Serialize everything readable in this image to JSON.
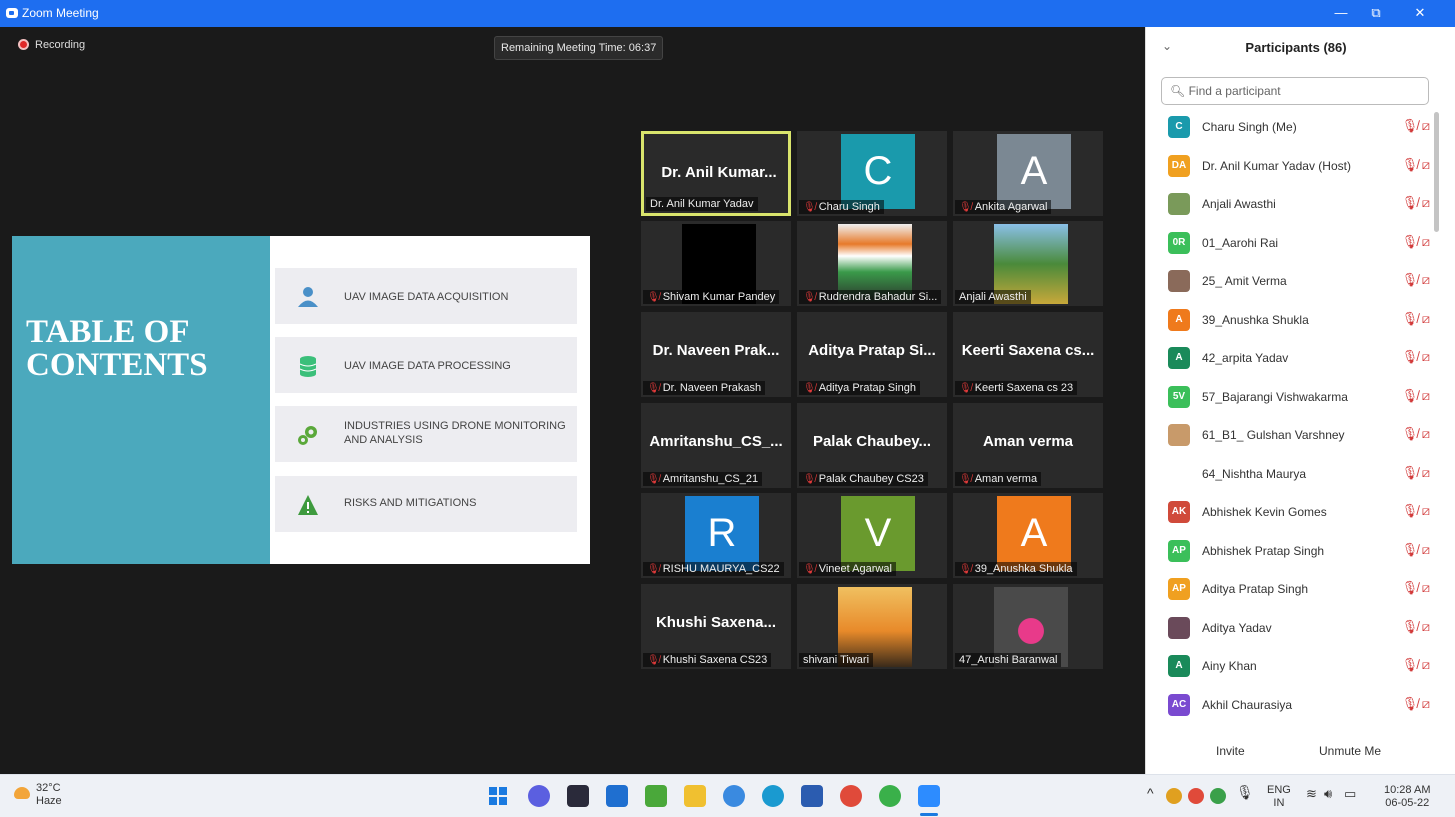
{
  "window": {
    "title": "Zoom Meeting",
    "min": "—",
    "restore": "⧉",
    "close": "✕"
  },
  "recording": "Recording",
  "timer": "Remaining Meeting Time: 06:37",
  "slide": {
    "title_line1": "TABLE OF",
    "title_line2": "CONTENTS",
    "items": [
      {
        "label": "UAV IMAGE DATA ACQUISITION",
        "icon": "person-icon",
        "color": "#4a90c8"
      },
      {
        "label": "UAV IMAGE DATA  PROCESSING",
        "icon": "database-icon",
        "color": "#3bbf7a"
      },
      {
        "label": "INDUSTRIES USING DRONE MONITORING AND ANALYSIS",
        "icon": "gears-icon",
        "color": "#5aa83a"
      },
      {
        "label": "RISKS AND MITIGATIONS",
        "icon": "warning-icon",
        "color": "#3e9a3e"
      }
    ]
  },
  "tiles": [
    {
      "big": "Dr. Anil Kumar...",
      "name": "Dr. Anil Kumar Yadav",
      "muted": false,
      "active": true
    },
    {
      "avatar": "C",
      "avatar_color": "#1a9aac",
      "name": "Charu Singh",
      "muted": true
    },
    {
      "avatar": "A",
      "avatar_color": "#7b8893",
      "name": "Ankita Agarwal",
      "muted": true
    },
    {
      "photo": "black",
      "name": "Shivam Kumar Pandey",
      "muted": true
    },
    {
      "photo": "person",
      "name": "Rudrendra Bahadur Si...",
      "muted": true
    },
    {
      "photo": "garden",
      "name": "Anjali Awasthi",
      "muted": false
    },
    {
      "big": "Dr. Naveen Prak...",
      "name": "Dr. Naveen Prakash",
      "muted": true
    },
    {
      "big": "Aditya Pratap Si...",
      "name": "Aditya Pratap Singh",
      "muted": true
    },
    {
      "big": "Keerti Saxena cs...",
      "name": "Keerti Saxena cs 23",
      "muted": true
    },
    {
      "big": "Amritanshu_CS_...",
      "name": "Amritanshu_CS_21",
      "muted": true
    },
    {
      "big": "Palak Chaubey...",
      "name": "Palak Chaubey  CS23",
      "muted": true
    },
    {
      "big": "Aman verma",
      "name": "Aman verma",
      "muted": true
    },
    {
      "avatar": "R",
      "avatar_color": "#1a7fd0",
      "name": "RISHU MAURYA_CS22",
      "muted": true
    },
    {
      "avatar": "V",
      "avatar_color": "#6a9a2e",
      "name": "Vineet Agarwal",
      "muted": true
    },
    {
      "avatar": "A",
      "avatar_color": "#ef7a1c",
      "name": "39_Anushka Shukla",
      "muted": true
    },
    {
      "big": "Khushi Saxena...",
      "name": "Khushi Saxena CS23",
      "muted": true
    },
    {
      "photo": "meditation",
      "name": "shivani Tiwari",
      "muted": false
    },
    {
      "photo": "flower",
      "name": "47_Arushi Baranwal",
      "muted": false
    }
  ],
  "participants": {
    "title": "Participants (86)",
    "search_placeholder": "Find a participant",
    "list": [
      {
        "initials": "C",
        "color": "#1a9aac",
        "name": "Charu Singh (Me)"
      },
      {
        "initials": "DA",
        "color": "#f0a020",
        "name": "Dr. Anil Kumar Yadav (Host)"
      },
      {
        "initials": "",
        "color": "#7a9a5a",
        "name": "Anjali Awasthi"
      },
      {
        "initials": "0R",
        "color": "#3bbf5a",
        "name": "01_Aarohi Rai"
      },
      {
        "initials": "",
        "color": "#8a6a5a",
        "name": "25_ Amit Verma"
      },
      {
        "initials": "A",
        "color": "#ef7a1c",
        "name": "39_Anushka Shukla"
      },
      {
        "initials": "A",
        "color": "#1a8a5a",
        "name": "42_arpita Yadav"
      },
      {
        "initials": "5V",
        "color": "#3bbf5a",
        "name": "57_Bajarangi Vishwakarma"
      },
      {
        "initials": "",
        "color": "#c89a6a",
        "name": "61_B1_ Gulshan Varshney"
      },
      {
        "initials": "",
        "color": "#ffffff",
        "name": "64_Nishtha Maurya"
      },
      {
        "initials": "AK",
        "color": "#d04a3a",
        "name": "Abhishek Kevin Gomes"
      },
      {
        "initials": "AP",
        "color": "#3bbf5a",
        "name": "Abhishek Pratap Singh"
      },
      {
        "initials": "AP",
        "color": "#f0a020",
        "name": "Aditya Pratap Singh"
      },
      {
        "initials": "",
        "color": "#6a4a5a",
        "name": "Aditya Yadav"
      },
      {
        "initials": "A",
        "color": "#1a8a5a",
        "name": "Ainy Khan"
      },
      {
        "initials": "AC",
        "color": "#7a4ad0",
        "name": "Akhil Chaurasiya"
      }
    ],
    "invite": "Invite",
    "unmute": "Unmute Me"
  },
  "taskbar": {
    "temp": "32°C",
    "weather": "Haze",
    "lang_top": "ENG",
    "lang_bottom": "IN",
    "time": "10:28 AM",
    "date": "06-05-22"
  }
}
